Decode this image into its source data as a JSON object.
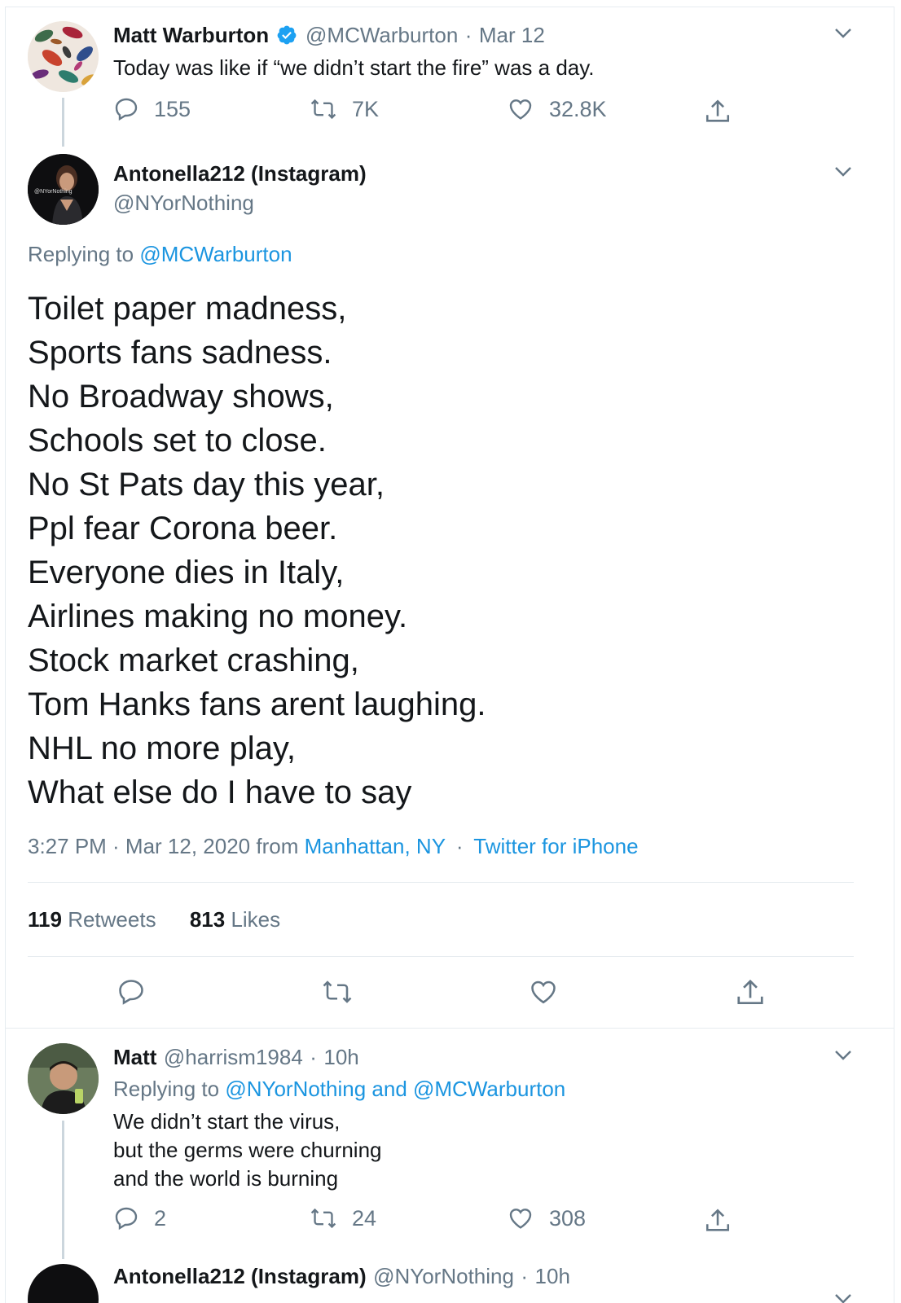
{
  "tweet1": {
    "display_name": "Matt Warburton",
    "handle": "@MCWarburton",
    "sep": "·",
    "date": "Mar 12",
    "text": "Today was like if “we didn’t start the fire” was a day.",
    "replies": "155",
    "retweets": "7K",
    "likes": "32.8K"
  },
  "main_tweet": {
    "display_name": "Antonella212 (Instagram)",
    "handle": "@NYorNothing",
    "avatar_text": "@NYorNothing",
    "replying_prefix": "Replying to",
    "replying_to": "@MCWarburton",
    "lines": [
      "Toilet paper madness,",
      "Sports fans sadness.",
      "No Broadway shows,",
      "Schools set to close.",
      "No St Pats day this year,",
      "Ppl fear Corona beer.",
      "Everyone dies in Italy,",
      "Airlines making no money.",
      "Stock market crashing,",
      "Tom Hanks fans arent laughing.",
      "NHL no more play,",
      "What else do I have to say"
    ],
    "timestamp": "3:27 PM · Mar 12, 2020 from",
    "location": "Manhattan, NY",
    "sep": "·",
    "source": "Twitter for iPhone",
    "retweet_count": "119",
    "retweet_label": "Retweets",
    "like_count": "813",
    "like_label": "Likes"
  },
  "reply": {
    "display_name": "Matt",
    "handle": "@harrism1984",
    "sep": "·",
    "time": "10h",
    "replying_prefix": "Replying to",
    "replying_to": "@NYorNothing and @MCWarburton",
    "lines": [
      "We didn’t start the virus,",
      "but the germs were churning",
      "and the world is burning"
    ],
    "replies": "2",
    "retweets": "24",
    "likes": "308"
  },
  "next_tweet": {
    "display_name": "Antonella212 (Instagram)",
    "handle": "@NYorNothing",
    "sep": "·",
    "time": "10h"
  },
  "colors": {
    "accent": "#1b95e0",
    "secondary_text": "#657786",
    "verified": "#1da1f2",
    "divider": "#e6ecf0"
  },
  "icons": [
    "reply-icon",
    "retweet-icon",
    "like-icon",
    "share-icon",
    "chevron-down-icon",
    "verified-icon"
  ]
}
